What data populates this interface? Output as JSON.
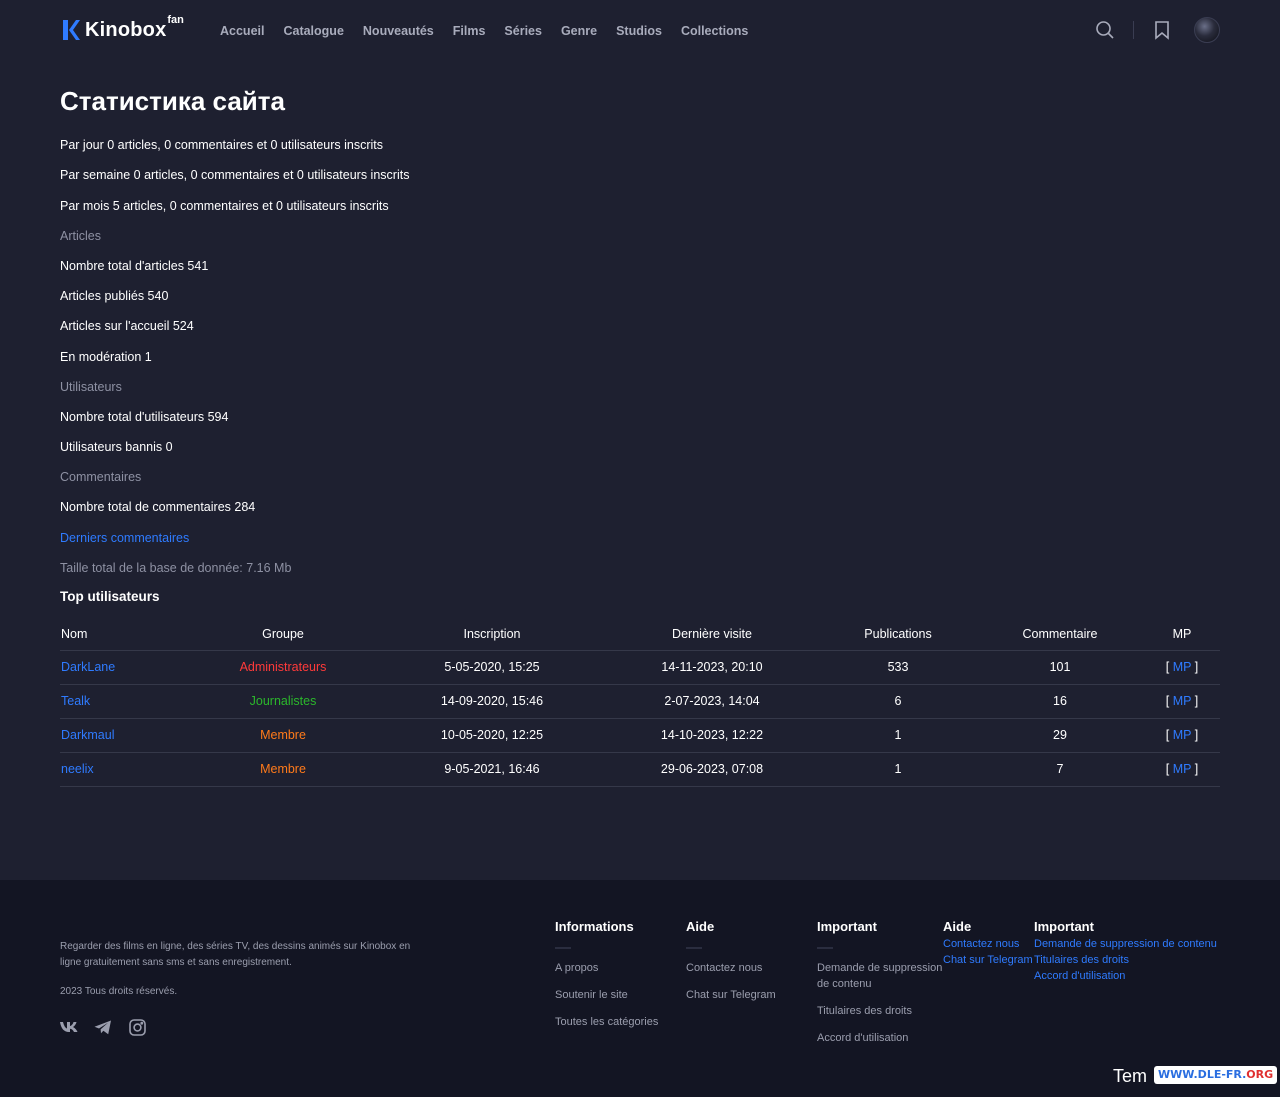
{
  "header": {
    "logo_text": "Kinobox",
    "logo_sup": "fan",
    "nav": [
      "Accueil",
      "Catalogue",
      "Nouveautés",
      "Films",
      "Séries",
      "Genre",
      "Studios",
      "Collections"
    ],
    "icons": [
      "search-icon",
      "bookmark-icon",
      "avatar"
    ]
  },
  "main": {
    "title": "Статистика сайта",
    "stats": [
      {
        "text": "Par jour 0 articles, 0 commentaires et 0 utilisateurs inscrits",
        "style": "normal"
      },
      {
        "text": "Par semaine 0 articles, 0 commentaires et 0 utilisateurs inscrits",
        "style": "normal"
      },
      {
        "text": "Par mois 5 articles, 0 commentaires et 0 utilisateurs inscrits",
        "style": "normal"
      },
      {
        "text": "Articles",
        "style": "muted"
      },
      {
        "text": "Nombre total d'articles 541",
        "style": "normal"
      },
      {
        "text": "Articles publiés 540",
        "style": "normal"
      },
      {
        "text": "Articles sur l'accueil 524",
        "style": "normal"
      },
      {
        "text": "En modération 1",
        "style": "normal"
      },
      {
        "text": "Utilisateurs",
        "style": "muted"
      },
      {
        "text": "Nombre total d'utilisateurs 594",
        "style": "normal"
      },
      {
        "text": "Utilisateurs bannis 0",
        "style": "normal"
      },
      {
        "text": "Commentaires",
        "style": "muted"
      },
      {
        "text": "Nombre total de commentaires 284",
        "style": "normal"
      },
      {
        "text": "Derniers commentaires",
        "style": "link"
      },
      {
        "text": "Taille total de la base de donnée: 7.16 Mb",
        "style": "muted"
      }
    ],
    "top_users_title": "Top utilisateurs",
    "table": {
      "headers": [
        "Nom",
        "Groupe",
        "Inscription",
        "Dernière visite",
        "Publications",
        "Commentaire",
        "MP"
      ],
      "rows": [
        {
          "name": "DarkLane",
          "group": "Administrateurs",
          "group_type": "admin",
          "inscription": "5-05-2020, 15:25",
          "last_visit": "14-11-2023, 20:10",
          "publications": "533",
          "comments": "101",
          "mp": "MP"
        },
        {
          "name": "Tealk",
          "group": "Journalistes",
          "group_type": "journ",
          "inscription": "14-09-2020, 15:46",
          "last_visit": "2-07-2023, 14:04",
          "publications": "6",
          "comments": "16",
          "mp": "MP"
        },
        {
          "name": "Darkmaul",
          "group": "Membre",
          "group_type": "membre",
          "inscription": "10-05-2020, 12:25",
          "last_visit": "14-10-2023, 12:22",
          "publications": "1",
          "comments": "29",
          "mp": "MP"
        },
        {
          "name": "neelix",
          "group": "Membre",
          "group_type": "membre",
          "inscription": "9-05-2021, 16:46",
          "last_visit": "29-06-2023, 07:08",
          "publications": "1",
          "comments": "7",
          "mp": "MP"
        }
      ]
    }
  },
  "footer": {
    "description": "Regarder des films en ligne, des séries TV, des dessins animés sur Kinobox en ligne gratuitement sans sms et sans enregistrement.",
    "copyright": "2023 Tous droits réservés.",
    "socials": [
      "vk-icon",
      "telegram-icon",
      "instagram-icon"
    ],
    "col_informations": {
      "title": "Informations",
      "links": [
        "A propos",
        "Soutenir le site",
        "Toutes les catégories"
      ]
    },
    "col_aide": {
      "title": "Aide",
      "links": [
        "Contactez nous",
        "Chat sur Telegram"
      ]
    },
    "col_important": {
      "title": "Important",
      "links": [
        "Demande de suppression de contenu",
        "Titulaires des droits",
        "Accord d'utilisation"
      ]
    },
    "col_aide2": {
      "title": "Aide",
      "links": [
        "Contactez nous",
        "Chat sur Telegram"
      ]
    },
    "col_important2": {
      "title": "Important",
      "links": [
        "Demande de suppression de contenu",
        "Titulaires des droits",
        "Accord d'utilisation"
      ]
    },
    "tem_text": "Tem",
    "badge_part1": "WWW.DLE-FR.",
    "badge_part2": "ORG"
  }
}
